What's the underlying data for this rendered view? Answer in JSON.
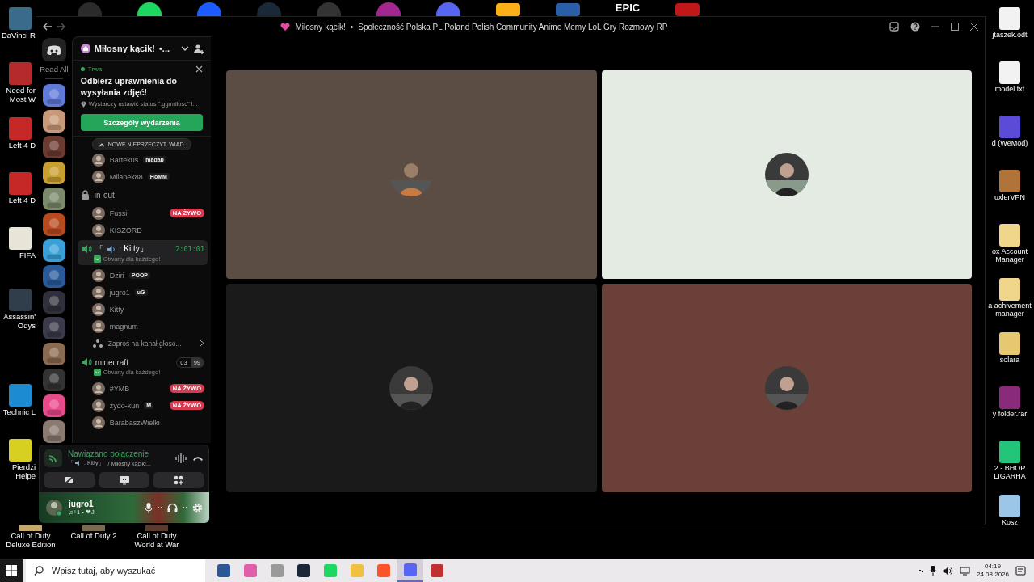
{
  "desktop": {
    "top_icons": [
      {
        "kind": "circle",
        "color": "#2b2b2b"
      },
      {
        "kind": "circle",
        "color": "#1ed760"
      },
      {
        "kind": "circle",
        "color": "#1c5cff"
      },
      {
        "kind": "circle",
        "color": "#1b2838"
      },
      {
        "kind": "circle",
        "color": "#333333"
      },
      {
        "kind": "circle",
        "color": "#a3278f"
      },
      {
        "kind": "circle",
        "color": "#5865f2"
      },
      {
        "kind": "square",
        "color": "#fcaf17"
      },
      {
        "kind": "square",
        "color": "#2a5fa8"
      },
      {
        "kind": "text",
        "label": "EPIC"
      },
      {
        "kind": "square",
        "color": "#c01818"
      }
    ],
    "left_icons": [
      {
        "label": "DaVinci R",
        "color": "#3a6b8a"
      },
      {
        "label": "Need for Most W",
        "color": "#b52b2b"
      },
      {
        "label": "Left 4 D",
        "color": "#c62828"
      },
      {
        "label": "Left 4 D",
        "color": "#c62828"
      },
      {
        "label": "FIFA",
        "color": "#e8e4d8"
      },
      {
        "label": "Assassin' Odys",
        "color": "#2f3e4a"
      },
      {
        "label": "Technic L",
        "color": "#1d8bd1"
      },
      {
        "label": "Pierdzi Helpe",
        "color": "#d8d020"
      }
    ],
    "bottom_icons": [
      {
        "label": "Call of Duty Deluxe Edition",
        "color": "#c8a86a"
      },
      {
        "label": "Call of Duty 2",
        "color": "#7a6a50"
      },
      {
        "label": "Call of Duty World at War",
        "color": "#5a3a2a"
      }
    ],
    "right_icons": [
      {
        "label": "jtaszek.odt",
        "color": "#f2f2f2"
      },
      {
        "label": "model.txt",
        "color": "#f2f2f2"
      },
      {
        "label": "d (WeMod)",
        "color": "#5b4bd8"
      },
      {
        "label": "uxlerVPN",
        "color": "#b0733a"
      },
      {
        "label": "ox Account Manager",
        "color": "#f0d68a"
      },
      {
        "label": "a achivement manager",
        "color": "#f0d68a"
      },
      {
        "label": "solara",
        "color": "#e6c870"
      },
      {
        "label": "y folder.rar",
        "color": "#8a2a7a"
      },
      {
        "label": "2 - BHOP LIGARHA",
        "color": "#22c57a"
      },
      {
        "label": "Kosz",
        "color": "#9cc6e8"
      }
    ]
  },
  "window": {
    "server_title": "Miłosny kącik!",
    "separator": "•",
    "server_description": "Społeczność Polska PL Poland Polish Community Anime Memy LoL Gry Rozmowy RP"
  },
  "server_list": {
    "read_all": "Read All"
  },
  "channel_panel": {
    "server_name": "Miłosny kącik!",
    "server_suffix": "•...",
    "event": {
      "status": "Trwa",
      "title": "Odbierz uprawnienia do wysyłania zdjęć!",
      "location": "Wystarczy ustawić status \".gg/milosc\" l...",
      "button": "Szczegóły wydarzenia"
    },
    "new_messages": "NOWE NIEPRZECZYT. WIAD.",
    "items": [
      {
        "kind": "user",
        "name": "Bartekus",
        "tag": "madab",
        "live": false
      },
      {
        "kind": "user",
        "name": "Milanek88",
        "tag": "HoMM",
        "live": false
      },
      {
        "kind": "category",
        "name": "in-out"
      },
      {
        "kind": "user",
        "name": "Fussi",
        "live": true,
        "live_label": "NA ŻYWO"
      },
      {
        "kind": "user",
        "name": "KISZORD",
        "live": false
      },
      {
        "kind": "voice",
        "name_open": "「",
        "name_rest": ": Kitty」",
        "selected": true,
        "timer": "2:01:01",
        "subtitle": "Otwarty dla każdego!"
      },
      {
        "kind": "user",
        "name": "Dziri",
        "tag": "POOP",
        "live": false
      },
      {
        "kind": "user",
        "name": "jugro1",
        "tag": "uG",
        "live": false
      },
      {
        "kind": "user",
        "name": "Kitty",
        "live": false
      },
      {
        "kind": "user",
        "name": "magnum",
        "live": false
      },
      {
        "kind": "invite",
        "name": "Zaproś na kanał głoso..."
      },
      {
        "kind": "voice",
        "name_rest": "minecraft",
        "selected": false,
        "count": "03",
        "limit": "99",
        "subtitle": "Otwarty dla każdego!"
      },
      {
        "kind": "user",
        "name": "#YMB",
        "live": true,
        "live_label": "NA ŻYWO"
      },
      {
        "kind": "user",
        "name": "żydo-kun",
        "tag": "M",
        "live": true,
        "live_label": "NA ŻYWO"
      },
      {
        "kind": "user",
        "name": "BarabaszWielki",
        "live": false
      }
    ]
  },
  "voice_panel": {
    "status": "Nawiązano połączenie",
    "channel_open": "「",
    "channel_rest": ": Kitty」",
    "server": "/ Miłosny kącik!..."
  },
  "user_panel": {
    "name": "jugro1",
    "status": "♫+1 • ❤J",
    "muted": false
  },
  "video_tiles": [
    {
      "color": "#5c4d44"
    },
    {
      "color": "#e4ebe2"
    },
    {
      "color": "#1a1a1a"
    },
    {
      "color": "#6b4038"
    }
  ],
  "taskbar": {
    "search_placeholder": "Wpisz tutaj, aby wyszukać",
    "apps": [
      {
        "color": "#2b5797"
      },
      {
        "color": "#e05fa8"
      },
      {
        "color": "#9a9a9a"
      },
      {
        "color": "#1b2838"
      },
      {
        "color": "#1ed760"
      },
      {
        "color": "#f0c040"
      },
      {
        "color": "#fb542b"
      },
      {
        "color": "#5865f2",
        "selected": true
      },
      {
        "color": "#c03030",
        "selected": false
      }
    ],
    "time": "04:19",
    "date": "24.08.2026"
  }
}
